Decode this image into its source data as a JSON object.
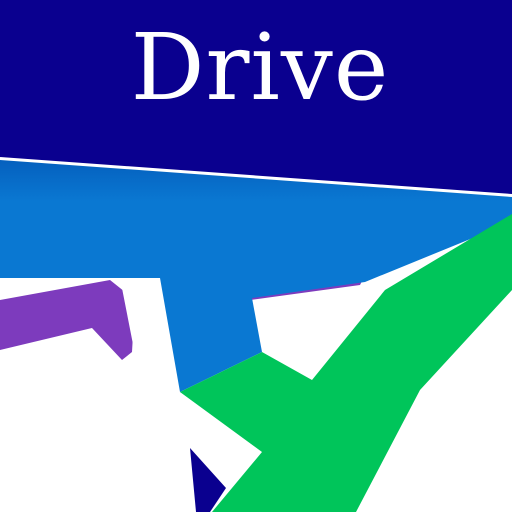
{
  "app_icon": {
    "name": "Drive",
    "colors": {
      "navy": "#0a008f",
      "blue": "#0a78d2",
      "green": "#00c55a",
      "purple": "#7d3bbd",
      "white": "#ffffff"
    }
  }
}
